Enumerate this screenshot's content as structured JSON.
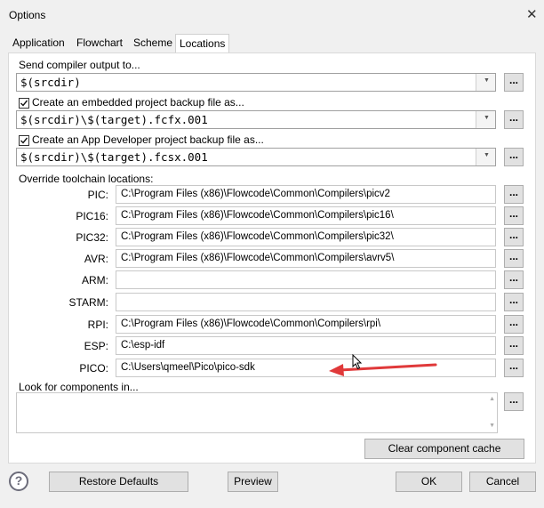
{
  "window": {
    "title": "Options",
    "close_glyph": "✕"
  },
  "tabs": [
    {
      "label": "Application",
      "active": false
    },
    {
      "label": "Flowchart",
      "active": false
    },
    {
      "label": "Scheme",
      "active": false
    },
    {
      "label": "Locations",
      "active": true
    }
  ],
  "compiler_output": {
    "label": "Send compiler output to...",
    "value": "$(srcdir)",
    "browse_label": "..."
  },
  "embedded_backup": {
    "label": "Create an embedded project backup file as...",
    "checked": true,
    "value": "$(srcdir)\\$(target).fcfx.001",
    "browse_label": "..."
  },
  "appdev_backup": {
    "label": "Create an App Developer project backup file as...",
    "checked": true,
    "value": "$(srcdir)\\$(target).fcsx.001",
    "browse_label": "..."
  },
  "toolchain": {
    "heading": "Override toolchain locations:",
    "browse_label": "...",
    "rows": [
      {
        "label": "PIC:",
        "value": "C:\\Program Files (x86)\\Flowcode\\Common\\Compilers\\picv2"
      },
      {
        "label": "PIC16:",
        "value": "C:\\Program Files (x86)\\Flowcode\\Common\\Compilers\\pic16\\"
      },
      {
        "label": "PIC32:",
        "value": "C:\\Program Files (x86)\\Flowcode\\Common\\Compilers\\pic32\\"
      },
      {
        "label": "AVR:",
        "value": "C:\\Program Files (x86)\\Flowcode\\Common\\Compilers\\avrv5\\"
      },
      {
        "label": "ARM:",
        "value": ""
      },
      {
        "label": "STARM:",
        "value": ""
      },
      {
        "label": "RPI:",
        "value": "C:\\Program Files (x86)\\Flowcode\\Common\\Compilers\\rpi\\"
      },
      {
        "label": "ESP:",
        "value": "C:\\esp-idf"
      },
      {
        "label": "PICO:",
        "value": "C:\\Users\\qmeel\\Pico\\pico-sdk"
      }
    ]
  },
  "components": {
    "label": "Look for components in...",
    "browse_label": "...",
    "clear_label": "Clear component cache"
  },
  "footer": {
    "help_glyph": "?",
    "restore_label": "Restore Defaults",
    "preview_label": "Preview",
    "ok_label": "OK",
    "cancel_label": "Cancel"
  },
  "annotation": {
    "arrow_color": "#e0393a",
    "pointer": "mouse-cursor"
  },
  "icons": {
    "dropdown": "chevron-down-icon",
    "checkbox": "checkmark-icon",
    "help": "help-icon"
  }
}
